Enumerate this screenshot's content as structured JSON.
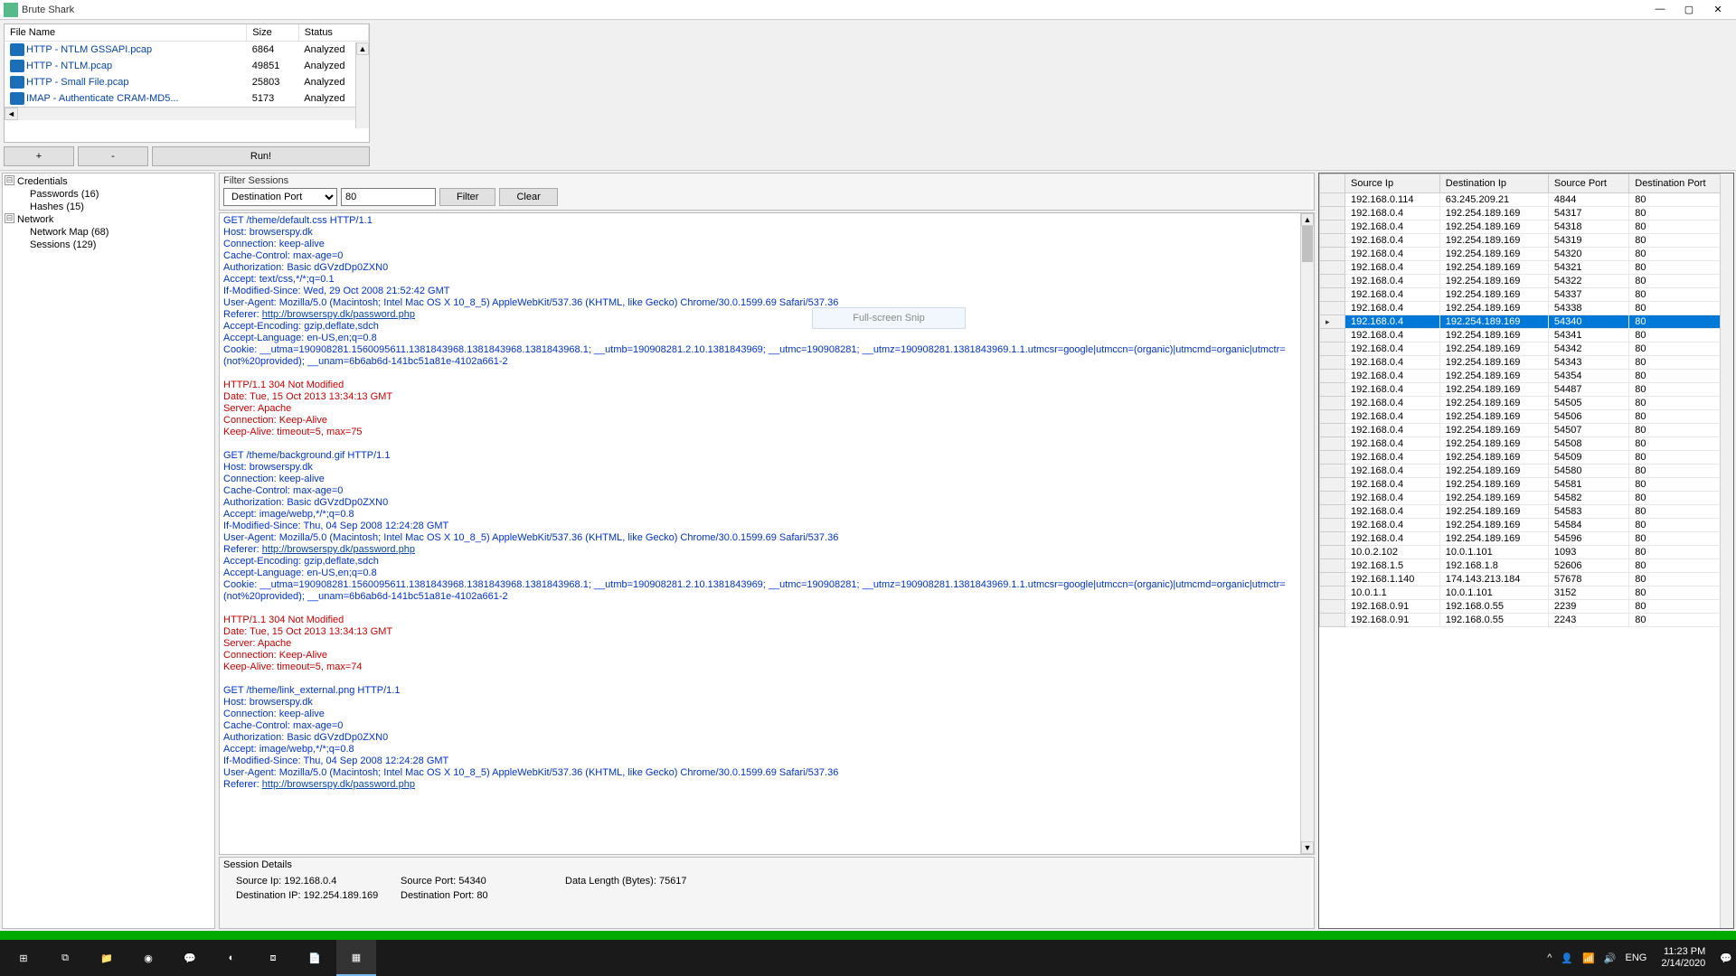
{
  "window": {
    "title": "Brute Shark"
  },
  "files": {
    "cols": [
      "File Name",
      "Size",
      "Status"
    ],
    "rows": [
      {
        "name": "HTTP - NTLM GSSAPI.pcap",
        "size": "6864",
        "status": "Analyzed"
      },
      {
        "name": "HTTP - NTLM.pcap",
        "size": "49851",
        "status": "Analyzed"
      },
      {
        "name": "HTTP - Small File.pcap",
        "size": "25803",
        "status": "Analyzed"
      },
      {
        "name": "IMAP - Authenticate CRAM-MD5...",
        "size": "5173",
        "status": "Analyzed"
      }
    ]
  },
  "buttons": {
    "plus": "+",
    "minus": "-",
    "run": "Run!"
  },
  "tree": {
    "nodes": [
      {
        "label": "Credentials",
        "children": [
          "Passwords (16)",
          "Hashes (15)"
        ]
      },
      {
        "label": "Network",
        "children": [
          "Network Map (68)",
          "Sessions (129)"
        ]
      }
    ]
  },
  "filter": {
    "title": "Filter Sessions",
    "field": "Destination Port",
    "value": "80",
    "filter_btn": "Filter",
    "clear_btn": "Clear"
  },
  "http_blocks": [
    {
      "type": "req",
      "lines": [
        "GET /theme/default.css HTTP/1.1",
        "Host: browserspy.dk",
        "Connection: keep-alive",
        "Cache-Control: max-age=0",
        "Authorization: Basic dGVzdDp0ZXN0",
        "Accept: text/css,*/*;q=0.1",
        "If-Modified-Since: Wed, 29 Oct 2008 21:52:42 GMT",
        "User-Agent: Mozilla/5.0 (Macintosh; Intel Mac OS X 10_8_5) AppleWebKit/537.36 (KHTML, like Gecko) Chrome/30.0.1599.69 Safari/537.36",
        "Referer: http://browserspy.dk/password.php",
        "Accept-Encoding: gzip,deflate,sdch",
        "Accept-Language: en-US,en;q=0.8",
        "Cookie: __utma=190908281.1560095611.1381843968.1381843968.1381843968.1; __utmb=190908281.2.10.1381843969; __utmc=190908281; __utmz=190908281.1381843969.1.1.utmcsr=google|utmccn=(organic)|utmcmd=organic|utmctr=(not%20provided); __unam=6b6ab6d-141bc51a81e-4102a661-2"
      ]
    },
    {
      "type": "resp",
      "lines": [
        "HTTP/1.1 304 Not Modified",
        "Date: Tue, 15 Oct 2013 13:34:13 GMT",
        "Server: Apache",
        "Connection: Keep-Alive",
        "Keep-Alive: timeout=5, max=75"
      ]
    },
    {
      "type": "req",
      "lines": [
        "GET /theme/background.gif HTTP/1.1",
        "Host: browserspy.dk",
        "Connection: keep-alive",
        "Cache-Control: max-age=0",
        "Authorization: Basic dGVzdDp0ZXN0",
        "Accept: image/webp,*/*;q=0.8",
        "If-Modified-Since: Thu, 04 Sep 2008 12:24:28 GMT",
        "User-Agent: Mozilla/5.0 (Macintosh; Intel Mac OS X 10_8_5) AppleWebKit/537.36 (KHTML, like Gecko) Chrome/30.0.1599.69 Safari/537.36",
        "Referer: http://browserspy.dk/password.php",
        "Accept-Encoding: gzip,deflate,sdch",
        "Accept-Language: en-US,en;q=0.8",
        "Cookie: __utma=190908281.1560095611.1381843968.1381843968.1381843968.1; __utmb=190908281.2.10.1381843969; __utmc=190908281; __utmz=190908281.1381843969.1.1.utmcsr=google|utmccn=(organic)|utmcmd=organic|utmctr=(not%20provided); __unam=6b6ab6d-141bc51a81e-4102a661-2"
      ]
    },
    {
      "type": "resp",
      "lines": [
        "HTTP/1.1 304 Not Modified",
        "Date: Tue, 15 Oct 2013 13:34:13 GMT",
        "Server: Apache",
        "Connection: Keep-Alive",
        "Keep-Alive: timeout=5, max=74"
      ]
    },
    {
      "type": "req",
      "lines": [
        "GET /theme/link_external.png HTTP/1.1",
        "Host: browserspy.dk",
        "Connection: keep-alive",
        "Cache-Control: max-age=0",
        "Authorization: Basic dGVzdDp0ZXN0",
        "Accept: image/webp,*/*;q=0.8",
        "If-Modified-Since: Thu, 04 Sep 2008 12:24:28 GMT",
        "User-Agent: Mozilla/5.0 (Macintosh; Intel Mac OS X 10_8_5) AppleWebKit/537.36 (KHTML, like Gecko) Chrome/30.0.1599.69 Safari/537.36",
        "Referer: http://browserspy.dk/password.php"
      ]
    }
  ],
  "session_details": {
    "title": "Session Details",
    "source_ip_lbl": "Source Ip:",
    "source_ip": "192.168.0.4",
    "source_port_lbl": "Source Port:",
    "source_port": "54340",
    "dest_ip_lbl": "Destination IP:",
    "dest_ip": "192.254.189.169",
    "dest_port_lbl": "Destination Port:",
    "dest_port": "80",
    "datalen_lbl": "Data Length (Bytes):",
    "datalen": "75617"
  },
  "sessions": {
    "cols": [
      "Source Ip",
      "Destination Ip",
      "Source Port",
      "Destination Port"
    ],
    "selected_src_port": "54340",
    "rows": [
      [
        "192.168.0.114",
        "63.245.209.21",
        "4844",
        "80"
      ],
      [
        "192.168.0.4",
        "192.254.189.169",
        "54317",
        "80"
      ],
      [
        "192.168.0.4",
        "192.254.189.169",
        "54318",
        "80"
      ],
      [
        "192.168.0.4",
        "192.254.189.169",
        "54319",
        "80"
      ],
      [
        "192.168.0.4",
        "192.254.189.169",
        "54320",
        "80"
      ],
      [
        "192.168.0.4",
        "192.254.189.169",
        "54321",
        "80"
      ],
      [
        "192.168.0.4",
        "192.254.189.169",
        "54322",
        "80"
      ],
      [
        "192.168.0.4",
        "192.254.189.169",
        "54337",
        "80"
      ],
      [
        "192.168.0.4",
        "192.254.189.169",
        "54338",
        "80"
      ],
      [
        "192.168.0.4",
        "192.254.189.169",
        "54340",
        "80"
      ],
      [
        "192.168.0.4",
        "192.254.189.169",
        "54341",
        "80"
      ],
      [
        "192.168.0.4",
        "192.254.189.169",
        "54342",
        "80"
      ],
      [
        "192.168.0.4",
        "192.254.189.169",
        "54343",
        "80"
      ],
      [
        "192.168.0.4",
        "192.254.189.169",
        "54354",
        "80"
      ],
      [
        "192.168.0.4",
        "192.254.189.169",
        "54487",
        "80"
      ],
      [
        "192.168.0.4",
        "192.254.189.169",
        "54505",
        "80"
      ],
      [
        "192.168.0.4",
        "192.254.189.169",
        "54506",
        "80"
      ],
      [
        "192.168.0.4",
        "192.254.189.169",
        "54507",
        "80"
      ],
      [
        "192.168.0.4",
        "192.254.189.169",
        "54508",
        "80"
      ],
      [
        "192.168.0.4",
        "192.254.189.169",
        "54509",
        "80"
      ],
      [
        "192.168.0.4",
        "192.254.189.169",
        "54580",
        "80"
      ],
      [
        "192.168.0.4",
        "192.254.189.169",
        "54581",
        "80"
      ],
      [
        "192.168.0.4",
        "192.254.189.169",
        "54582",
        "80"
      ],
      [
        "192.168.0.4",
        "192.254.189.169",
        "54583",
        "80"
      ],
      [
        "192.168.0.4",
        "192.254.189.169",
        "54584",
        "80"
      ],
      [
        "192.168.0.4",
        "192.254.189.169",
        "54596",
        "80"
      ],
      [
        "10.0.2.102",
        "10.0.1.101",
        "1093",
        "80"
      ],
      [
        "192.168.1.5",
        "192.168.1.8",
        "52606",
        "80"
      ],
      [
        "192.168.1.140",
        "174.143.213.184",
        "57678",
        "80"
      ],
      [
        "10.0.1.1",
        "10.0.1.101",
        "3152",
        "80"
      ],
      [
        "192.168.0.91",
        "192.168.0.55",
        "2239",
        "80"
      ],
      [
        "192.168.0.91",
        "192.168.0.55",
        "2243",
        "80"
      ]
    ]
  },
  "snip": "Full-screen Snip",
  "taskbar": {
    "time": "11:23 PM",
    "date": "2/14/2020",
    "lang": "ENG"
  }
}
